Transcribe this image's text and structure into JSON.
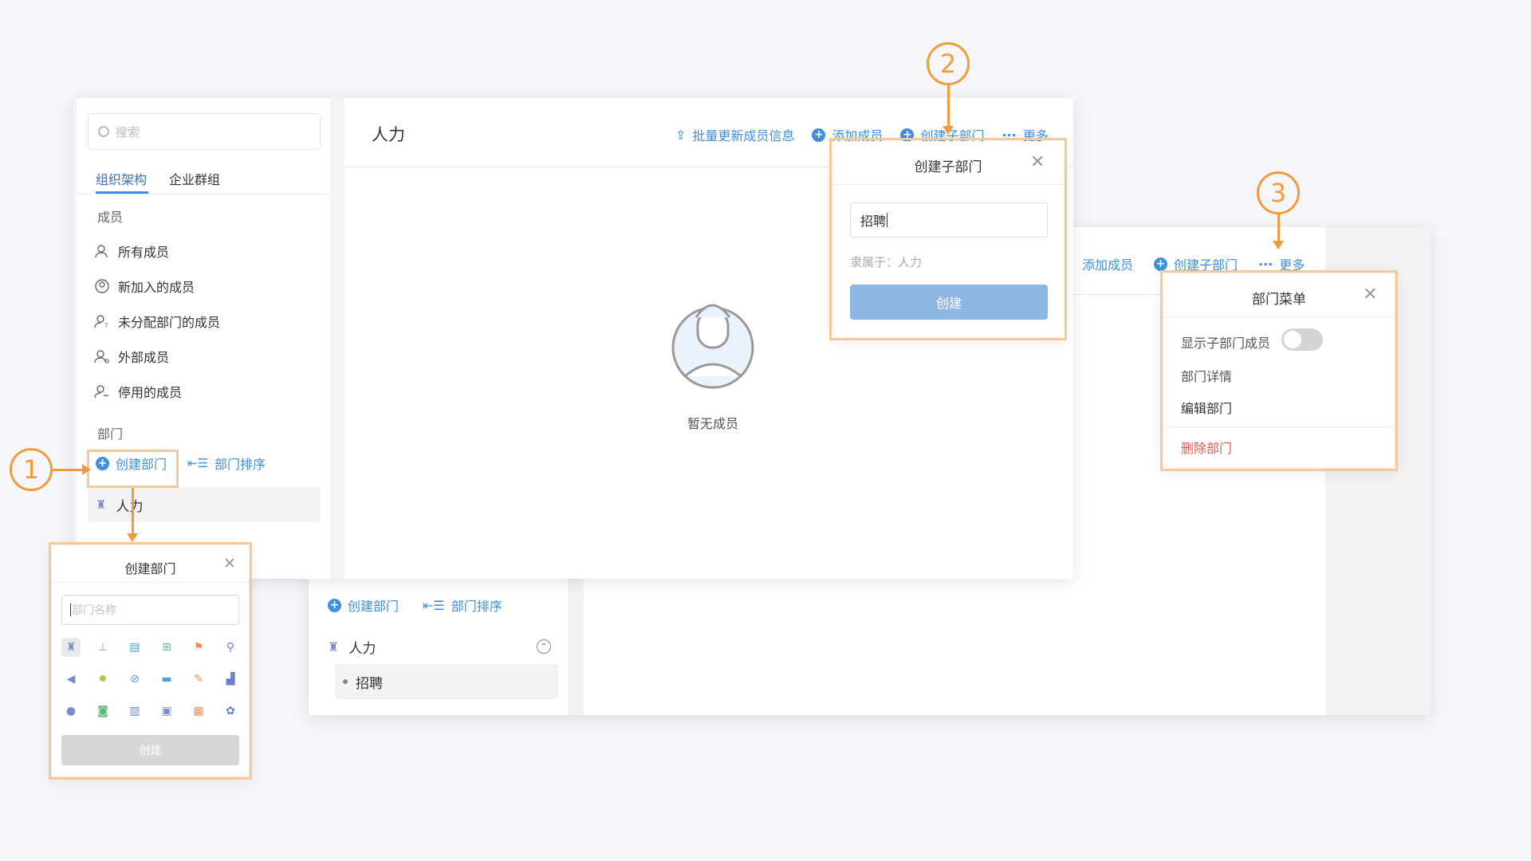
{
  "sidebar": {
    "search_placeholder": "搜索",
    "tabs": [
      "组织架构",
      "企业群组"
    ],
    "members_section": "成员",
    "member_items": [
      "所有成员",
      "新加入的成员",
      "未分配部门的成员",
      "外部成员",
      "停用的成员"
    ],
    "dept_section": "部门",
    "create_dept": "创建部门",
    "sort_dept": "部门排序",
    "dept_item": "人力"
  },
  "main": {
    "title": "人力",
    "toolbar": {
      "bulk_update": "批量更新成员信息",
      "add_member": "添加成员",
      "create_sub": "创建子部门",
      "more": "更多"
    },
    "empty_text": "暂无成员"
  },
  "sub_dialog": {
    "title": "创建子部门",
    "input_value": "招聘",
    "belongs": "隶属于：人力",
    "create_button": "创建"
  },
  "back_window": {
    "add_member": "添加成员",
    "create_sub": "创建子部门",
    "more": "更多",
    "create_dept": "创建部门",
    "sort_dept": "部门排序",
    "dept_item": "人力",
    "sub_item": "招聘"
  },
  "dept_menu": {
    "title": "部门菜单",
    "show_sub_members": "显示子部门成员",
    "toggle_on": false,
    "details": "部门详情",
    "edit": "编辑部门",
    "delete": "删除部门"
  },
  "create_dept_dialog": {
    "title": "创建部门",
    "placeholder": "部门名称",
    "create_button": "创建",
    "icons": [
      "tie-icon",
      "stamp-icon",
      "card-icon",
      "doc-plus-icon",
      "flag-icon",
      "pin-icon",
      "megaphone-icon",
      "bug-icon",
      "compass-icon",
      "briefcase-icon",
      "pen-icon",
      "chart-icon",
      "chat-icon",
      "camera-icon",
      "building-icon",
      "bus-icon",
      "grid-icon",
      "award-icon"
    ]
  },
  "annotations": [
    "1",
    "2",
    "3"
  ],
  "colors": {
    "accent": "#3d8fe0",
    "annotation": "#f39a3d",
    "danger": "#e8584f"
  }
}
